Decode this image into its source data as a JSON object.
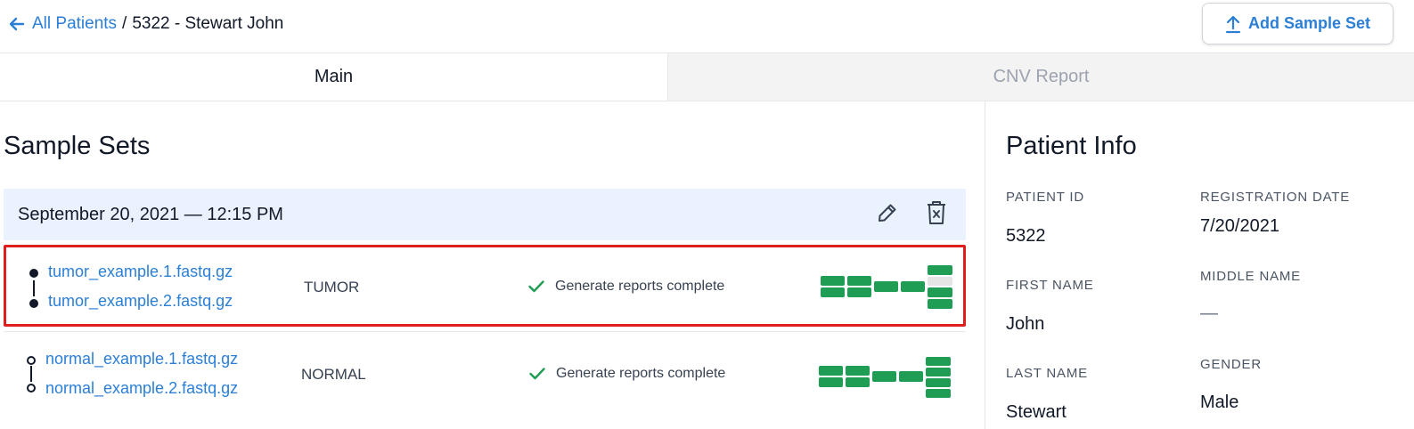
{
  "breadcrumb": {
    "back_label": "All Patients",
    "separator": "/",
    "current": "5322 - Stewart John"
  },
  "header": {
    "add_sample_set_label": "Add Sample Set"
  },
  "tabs": [
    {
      "label": "Main",
      "active": true
    },
    {
      "label": "CNV Report",
      "active": false
    }
  ],
  "sample_sets": {
    "title": "Sample Sets",
    "sets": [
      {
        "date": "September 20, 2021 — 12:15 PM",
        "samples": [
          {
            "file1": "tumor_example.1.fastq.gz",
            "file2": "tumor_example.2.fastq.gz",
            "type": "TUMOR",
            "status": "Generate reports complete",
            "highlighted": true
          },
          {
            "file1": "normal_example.1.fastq.gz",
            "file2": "normal_example.2.fastq.gz",
            "type": "NORMAL",
            "status": "Generate reports complete",
            "highlighted": false
          }
        ]
      }
    ]
  },
  "patient_info": {
    "title": "Patient Info",
    "fields": {
      "patient_id": {
        "label": "PATIENT ID",
        "value": "5322"
      },
      "registration_date": {
        "label": "REGISTRATION DATE",
        "value": "7/20/2021"
      },
      "first_name": {
        "label": "FIRST NAME",
        "value": "John"
      },
      "middle_name": {
        "label": "MIDDLE NAME",
        "value": "—"
      },
      "last_name": {
        "label": "LAST NAME",
        "value": "Stewart"
      },
      "gender": {
        "label": "GENDER",
        "value": "Male"
      }
    }
  },
  "colors": {
    "link": "#2b7fd6",
    "success": "#1f9d55",
    "pending": "#e5e5e5",
    "highlight": "#e01e1e",
    "set_header_bg": "#eaf2ff"
  },
  "icons": [
    "arrow-left-icon",
    "upload-icon",
    "pencil-icon",
    "trash-icon",
    "check-icon",
    "pair-link-icon"
  ]
}
